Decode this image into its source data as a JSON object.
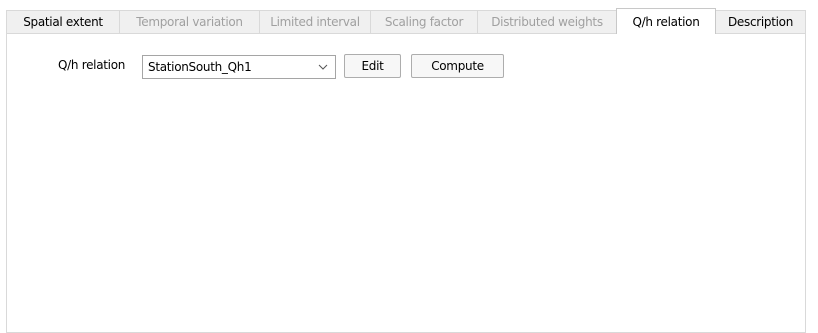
{
  "tabs": [
    {
      "label": "Spatial extent",
      "state": "normal"
    },
    {
      "label": "Temporal variation",
      "state": "disabled"
    },
    {
      "label": "Limited interval",
      "state": "disabled"
    },
    {
      "label": "Scaling factor",
      "state": "disabled"
    },
    {
      "label": "Distributed weights",
      "state": "disabled"
    },
    {
      "label": "Q/h relation",
      "state": "active"
    },
    {
      "label": "Description",
      "state": "normal"
    }
  ],
  "form": {
    "qh_label": "Q/h relation",
    "qh_value": "StationSouth_Qh1",
    "edit_label": "Edit",
    "compute_label": "Compute"
  },
  "colors": {
    "disabled_text": "#a0a0a0",
    "tab_bg": "#f0f0f0",
    "active_tab_bg": "#ffffff",
    "border": "#d9d9d9"
  },
  "icons": {
    "combo_arrow": "chevron-down-icon"
  }
}
